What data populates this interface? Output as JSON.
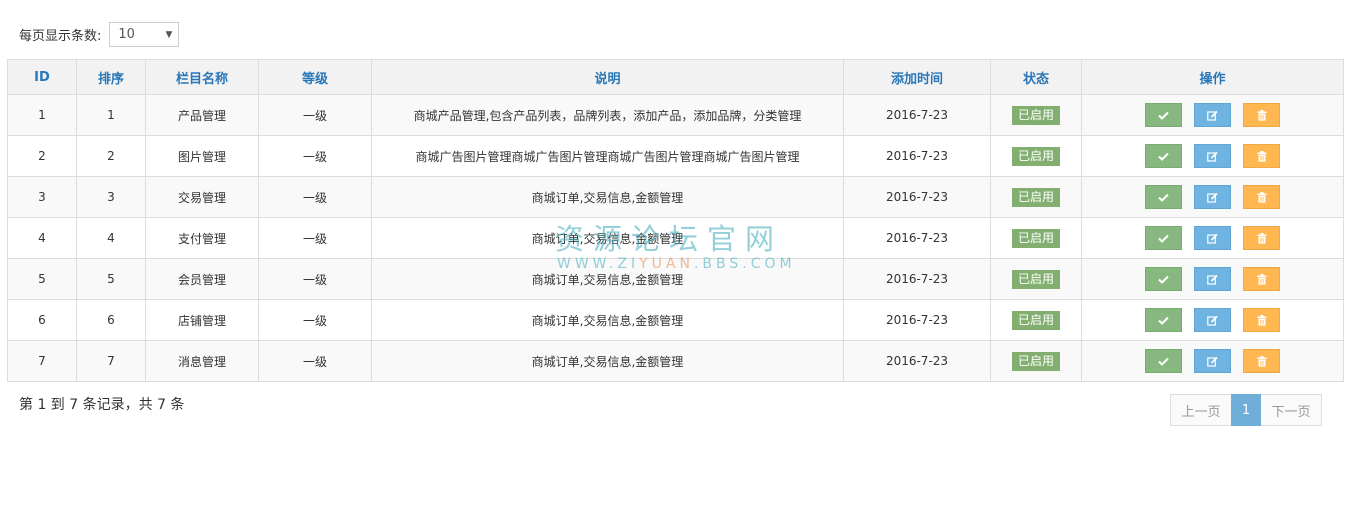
{
  "length_menu": {
    "label": "每页显示条数:",
    "selected": "10"
  },
  "table": {
    "columns": [
      "ID",
      "排序",
      "栏目名称",
      "等级",
      "说明",
      "添加时间",
      "状态",
      "操作"
    ],
    "rows": [
      {
        "id": "1",
        "order": "1",
        "name": "产品管理",
        "level": "一级",
        "desc": "商城产品管理,包含产品列表，品牌列表，添加产品，添加品牌，分类管理",
        "date": "2016-7-23",
        "status": "已启用"
      },
      {
        "id": "2",
        "order": "2",
        "name": "图片管理",
        "level": "一级",
        "desc": "商城广告图片管理商城广告图片管理商城广告图片管理商城广告图片管理",
        "date": "2016-7-23",
        "status": "已启用"
      },
      {
        "id": "3",
        "order": "3",
        "name": "交易管理",
        "level": "一级",
        "desc": "商城订单,交易信息,金额管理",
        "date": "2016-7-23",
        "status": "已启用"
      },
      {
        "id": "4",
        "order": "4",
        "name": "支付管理",
        "level": "一级",
        "desc": "商城订单,交易信息,金额管理",
        "date": "2016-7-23",
        "status": "已启用"
      },
      {
        "id": "5",
        "order": "5",
        "name": "会员管理",
        "level": "一级",
        "desc": "商城订单,交易信息,金额管理",
        "date": "2016-7-23",
        "status": "已启用"
      },
      {
        "id": "6",
        "order": "6",
        "name": "店铺管理",
        "level": "一级",
        "desc": "商城订单,交易信息,金额管理",
        "date": "2016-7-23",
        "status": "已启用"
      },
      {
        "id": "7",
        "order": "7",
        "name": "消息管理",
        "level": "一级",
        "desc": "商城订单,交易信息,金额管理",
        "date": "2016-7-23",
        "status": "已启用"
      }
    ],
    "action_icons": [
      "check-icon",
      "edit-icon",
      "trash-icon"
    ]
  },
  "info_text": "第 1 到 7 条记录，共 7 条",
  "pagination": {
    "prev": "上一页",
    "current": "1",
    "next": "下一页"
  },
  "watermark": {
    "cn": "资源论坛官网",
    "en_prefix": "WWW.ZI",
    "en_accent": "YUAN",
    "en_suffix": ".BBS.COM"
  },
  "colors": {
    "header_text": "#2a77b8",
    "status_badge": "#82af6f",
    "btn_ok": "#87b87f",
    "btn_edit": "#6fb3e0",
    "btn_delete": "#ffb752",
    "pager_active": "#6faed9"
  }
}
